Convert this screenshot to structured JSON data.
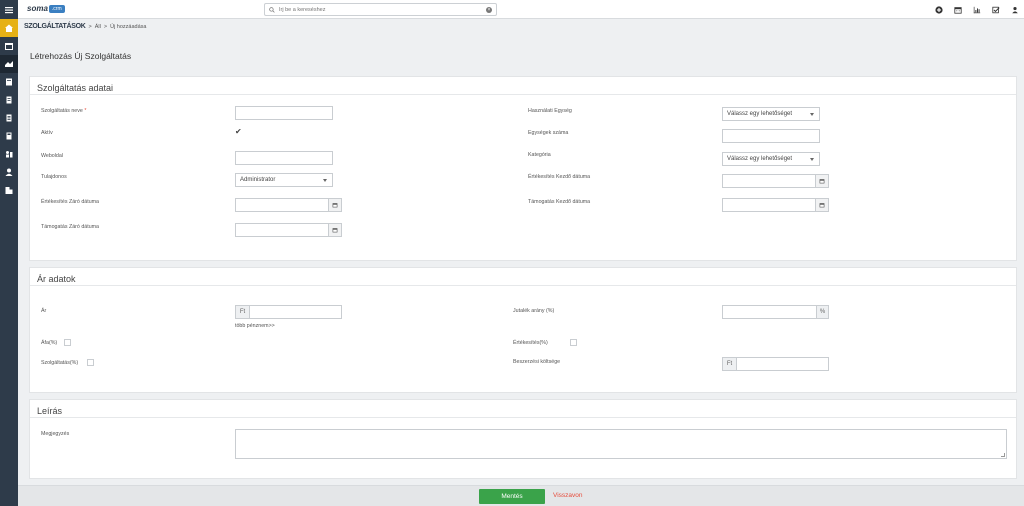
{
  "app": {
    "logo_text": "soma",
    "logo_badge": ".crm"
  },
  "search": {
    "placeholder": "Írj be a kereséshez"
  },
  "breadcrumb": {
    "section": "SZOLGÁLTATÁSOK",
    "level1": "Áll",
    "level2": "Új hozzáadása",
    "sep": ">"
  },
  "page": {
    "title": "Létrehozás Új Szolgáltatás"
  },
  "service_panel": {
    "title": "Szolgáltatás adatai",
    "name_label": "Szolgáltatás neve",
    "required_mark": "*",
    "active_label": "Aktív",
    "active_check": "✔",
    "website_label": "Weboldal",
    "owner_label": "Tulajdonos",
    "owner_value": "Administrator",
    "sales_end_label": "Értékesítés Záró dátuma",
    "support_end_label": "Támogatás Záró dátuma",
    "unit_label": "Használati Egység",
    "unit_value": "Válassz egy lehetőséget",
    "unit_count_label": "Egységek száma",
    "category_label": "Kategória",
    "category_value": "Válassz egy lehetőséget",
    "sales_start_label": "Értékesítés Kezdő dátuma",
    "support_start_label": "Támogatás Kezdő dátuma"
  },
  "price_panel": {
    "title": "Ár adatok",
    "price_label": "Ár",
    "currency": "Ft",
    "more_currencies": "több pénznem>>",
    "vat_label": "Áfa(%)",
    "service_pct_label": "Szolgáltatás(%)",
    "commission_label": "Jutalék arány (%)",
    "percent_sign": "%",
    "sales_pct_label": "Értékesítés(%)",
    "purchase_cost_label": "Beszerzési költsége",
    "purchase_currency": "Ft"
  },
  "desc_panel": {
    "title": "Leírás",
    "note_label": "Megjegyzés"
  },
  "footer": {
    "save_label": "Mentés",
    "cancel_label": "Visszavon"
  },
  "colors": {
    "sidebar": "#2e3b4a",
    "accent_yellow": "#e6b116",
    "save_green": "#3aa34a",
    "cancel_red": "#e74c3c"
  }
}
